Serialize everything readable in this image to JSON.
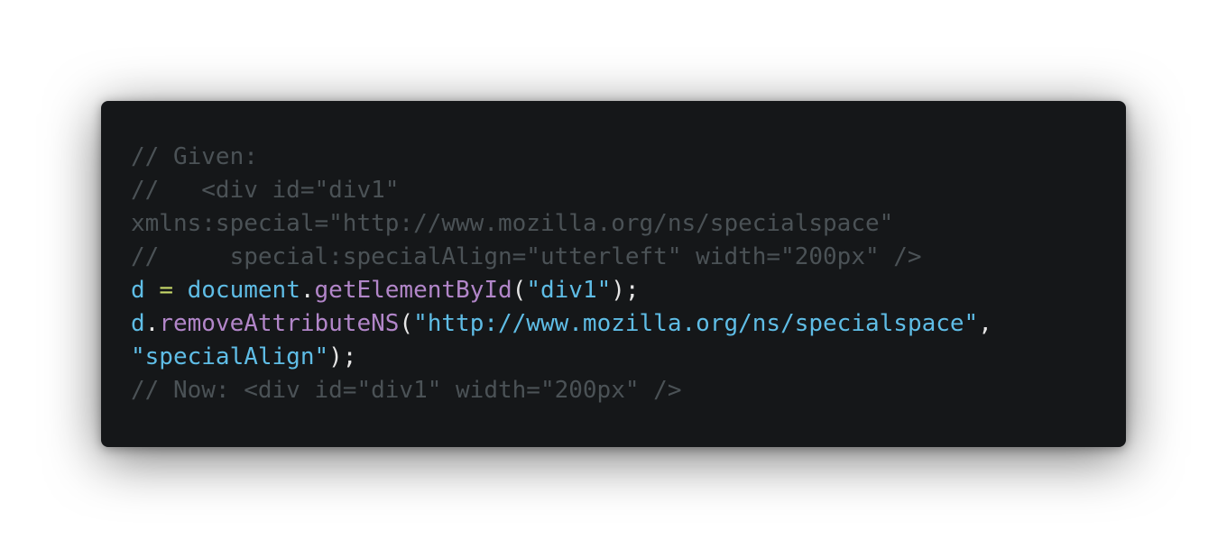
{
  "code_snippet": {
    "lines": [
      {
        "tokens": [
          {
            "type": "comment",
            "text": "// Given:"
          }
        ]
      },
      {
        "tokens": [
          {
            "type": "comment",
            "text": "//   <div id=\"div1\""
          }
        ]
      },
      {
        "tokens": [
          {
            "type": "comment",
            "text": "xmlns:special=\"http://www.mozilla.org/ns/specialspace\""
          }
        ]
      },
      {
        "tokens": [
          {
            "type": "comment",
            "text": "//     special:specialAlign=\"utterleft\" width=\"200px\" />"
          }
        ]
      },
      {
        "tokens": [
          {
            "type": "var",
            "text": "d"
          },
          {
            "type": "plain",
            "text": " "
          },
          {
            "type": "op",
            "text": "="
          },
          {
            "type": "plain",
            "text": " "
          },
          {
            "type": "var",
            "text": "document"
          },
          {
            "type": "plain",
            "text": "."
          },
          {
            "type": "method",
            "text": "getElementById"
          },
          {
            "type": "plain",
            "text": "("
          },
          {
            "type": "string",
            "text": "\"div1\""
          },
          {
            "type": "plain",
            "text": ");"
          }
        ]
      },
      {
        "tokens": [
          {
            "type": "var",
            "text": "d"
          },
          {
            "type": "plain",
            "text": "."
          },
          {
            "type": "method",
            "text": "removeAttributeNS"
          },
          {
            "type": "plain",
            "text": "("
          },
          {
            "type": "string",
            "text": "\"http://www.mozilla.org/ns/specialspace\""
          },
          {
            "type": "plain",
            "text": ","
          }
        ]
      },
      {
        "tokens": [
          {
            "type": "string",
            "text": "\"specialAlign\""
          },
          {
            "type": "plain",
            "text": ");"
          }
        ]
      },
      {
        "tokens": [
          {
            "type": "comment",
            "text": "// Now: <div id=\"div1\" width=\"200px\" />"
          }
        ]
      }
    ]
  },
  "colors": {
    "background": "#151719",
    "comment": "#4b5256",
    "variable": "#5fbde6",
    "operator": "#c8d96a",
    "method": "#b286c9",
    "string": "#5fbde6",
    "plain": "#e6e6e6"
  }
}
